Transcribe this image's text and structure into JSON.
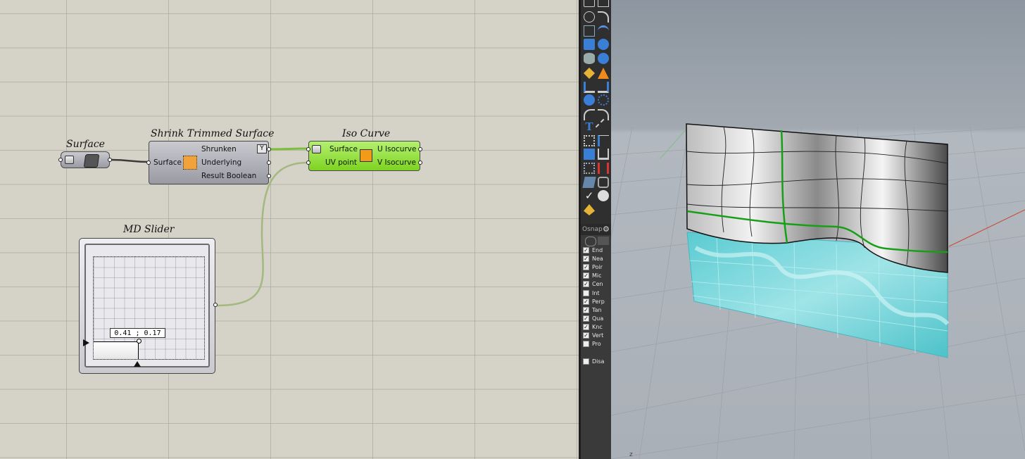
{
  "grasshopper": {
    "components": {
      "surface": {
        "title": "Surface"
      },
      "shrink": {
        "title": "Shrink Trimmed Surface",
        "input": "Surface",
        "outputs": [
          "Shrunken",
          "Underlying",
          "Result Boolean"
        ]
      },
      "iso_curve": {
        "title": "Iso Curve",
        "inputs": [
          "Surface",
          "UV point"
        ],
        "outputs": [
          "U Isocurve",
          "V Isocurve"
        ]
      },
      "md_slider": {
        "title": "MD Slider",
        "value": "0.41 ; 0.17",
        "u": 0.41,
        "v": 0.17
      }
    }
  },
  "rhino": {
    "osnap": {
      "header": "Osnap",
      "items": [
        {
          "label": "End",
          "checked": true
        },
        {
          "label": "Nea",
          "checked": true
        },
        {
          "label": "Poir",
          "checked": true
        },
        {
          "label": "Mic",
          "checked": true
        },
        {
          "label": "Cen",
          "checked": true
        },
        {
          "label": "Int",
          "checked": false
        },
        {
          "label": "Perp",
          "checked": true
        },
        {
          "label": "Tan",
          "checked": true
        },
        {
          "label": "Qua",
          "checked": true
        },
        {
          "label": "Knc",
          "checked": true
        },
        {
          "label": "Vert",
          "checked": true
        },
        {
          "label": "Pro",
          "checked": false
        }
      ],
      "disable": {
        "label": "Disa",
        "checked": false
      }
    },
    "axis_label": "z"
  },
  "colors": {
    "canvas": "#d5d2c8",
    "component_grey": "#a3a3ab",
    "component_green": "#8fdc2e",
    "wire_green": "#7cbf3a",
    "iso_curve": "#17a017",
    "underlying_surface": "#5ed6d9"
  }
}
